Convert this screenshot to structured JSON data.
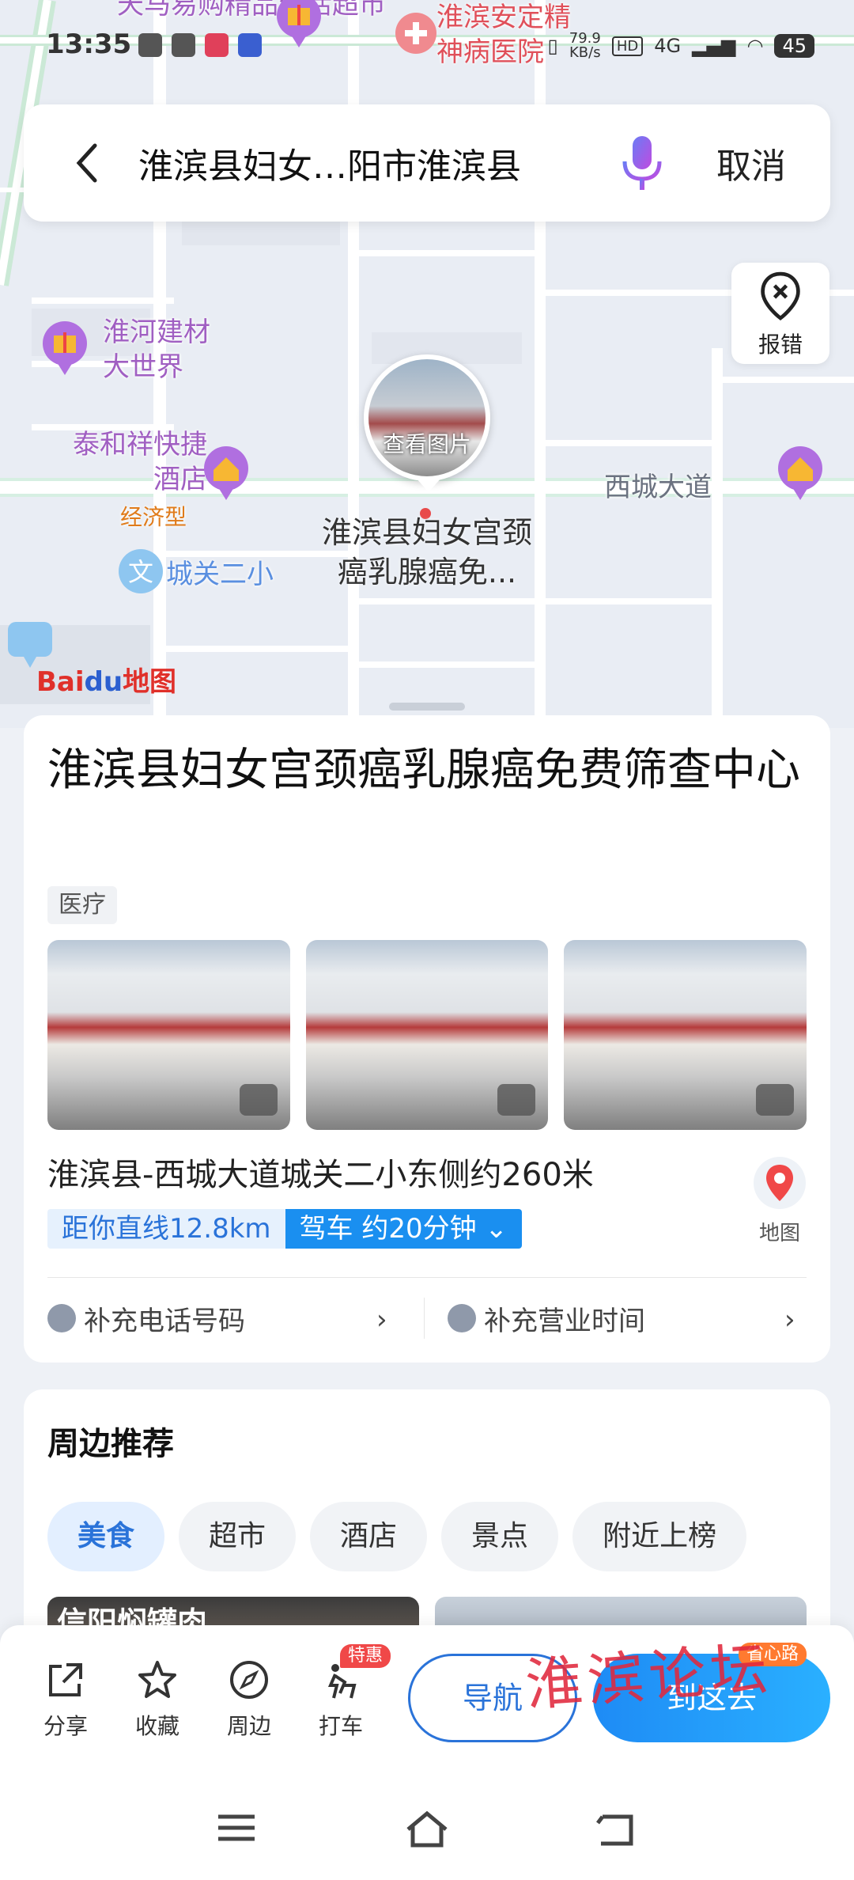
{
  "status_bar": {
    "time": "13:35",
    "net_speed": "79.9",
    "net_unit": "KB/s",
    "hd": "HD",
    "signal": "4G",
    "battery": "45"
  },
  "search": {
    "query": "淮滨县妇女…阳市淮滨县",
    "cancel_label": "取消"
  },
  "map": {
    "report_label": "报错",
    "photo_label": "查看图片",
    "pin_title": "淮滨县妇女宫颈癌乳腺癌免...",
    "pois": [
      {
        "label": "天马易购精品生活超市"
      },
      {
        "label": "淮滨安定精神病医院"
      },
      {
        "label": "淮河建材大世界"
      },
      {
        "label": "泰和祥快捷酒店"
      },
      {
        "label": "经济型"
      },
      {
        "label": "城关二小"
      },
      {
        "label": "西城大道"
      }
    ],
    "logo_bai": "Bai",
    "logo_du": "du",
    "logo_map": "地图"
  },
  "place": {
    "name": "淮滨县妇女宫颈癌乳腺癌免费筛查中心",
    "category": "医疗",
    "address": "淮滨县-西城大道城关二小东侧约260米",
    "distance": "距你直线12.8km",
    "drive": "驾车 约20分钟",
    "map_label": "地图",
    "add_phone": "补充电话号码",
    "add_hours": "补充营业时间"
  },
  "nearby": {
    "heading": "周边推荐",
    "chips": [
      "美食",
      "超市",
      "酒店",
      "景点",
      "附近上榜"
    ],
    "thumb_text": "信阳焖罐肉"
  },
  "bottom_bar": {
    "share": "分享",
    "favorite": "收藏",
    "nearby": "周边",
    "taxi": "打车",
    "taxi_badge": "特惠",
    "navigate": "导航",
    "go_here": "到这去",
    "go_badge": "省心路"
  },
  "watermark": "淮滨论坛",
  "colors": {
    "accent": "#1a8ff0",
    "poi_purple": "#a05fc2",
    "poi_red": "#e0505a",
    "road": "#ffffff"
  }
}
